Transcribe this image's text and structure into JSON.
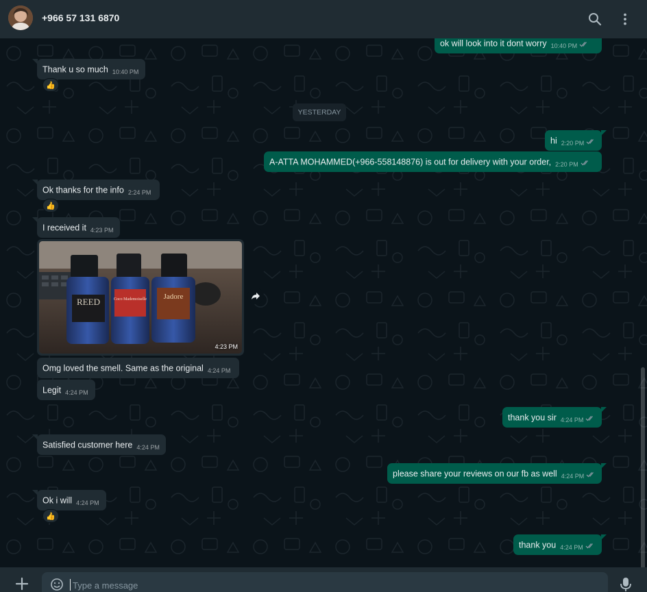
{
  "header": {
    "contact_name": "+966 57 131 6870",
    "icons": [
      "search-icon",
      "more-vertical-icon"
    ]
  },
  "chat": {
    "date_separator": "YESTERDAY",
    "messages": [
      {
        "direction": "out",
        "text": "ok will look into it dont worry",
        "time": "10:40 PM",
        "status": "read"
      },
      {
        "direction": "in",
        "text": "Thank u so much",
        "time": "10:40 PM",
        "reaction": "👍"
      },
      {
        "direction": "out",
        "text": "hi",
        "time": "2:20 PM",
        "status": "read"
      },
      {
        "direction": "out",
        "text": "A-ATTA MOHAMMED(+966-558148876) is out for delivery with your order,",
        "time": "2:20 PM",
        "status": "read"
      },
      {
        "direction": "in",
        "text": "Ok thanks for the info",
        "time": "2:24 PM",
        "reaction": "👍"
      },
      {
        "direction": "in",
        "text": "I received it",
        "time": "4:23 PM"
      },
      {
        "direction": "in",
        "type": "image",
        "image_label": "photo of three perfume bottles",
        "bottle_labels": [
          "REED",
          "Coco Mademoiselle",
          "Jadore"
        ],
        "time": "4:23 PM"
      },
      {
        "direction": "in",
        "text": "Omg loved the smell. Same as the original",
        "time": "4:24 PM"
      },
      {
        "direction": "in",
        "text": "Legit",
        "time": "4:24 PM"
      },
      {
        "direction": "out",
        "text": "thank you sir",
        "time": "4:24 PM",
        "status": "read"
      },
      {
        "direction": "in",
        "text": "Satisfied customer here",
        "time": "4:24 PM"
      },
      {
        "direction": "out",
        "text": "please share your reviews on our fb as well",
        "time": "4:24 PM",
        "status": "read"
      },
      {
        "direction": "in",
        "text": "Ok i will",
        "time": "4:24 PM",
        "reaction": "👍"
      },
      {
        "direction": "out",
        "text": "thank you",
        "time": "4:24 PM",
        "status": "read"
      }
    ]
  },
  "composer": {
    "placeholder": "Type a message",
    "value": ""
  },
  "colors": {
    "header_bg": "#202c33",
    "chat_bg": "#0b141a",
    "incoming_bubble": "#202c33",
    "outgoing_bubble": "#005c4b",
    "read_tick": "#8696a0",
    "meta_text": "#8696a0"
  }
}
